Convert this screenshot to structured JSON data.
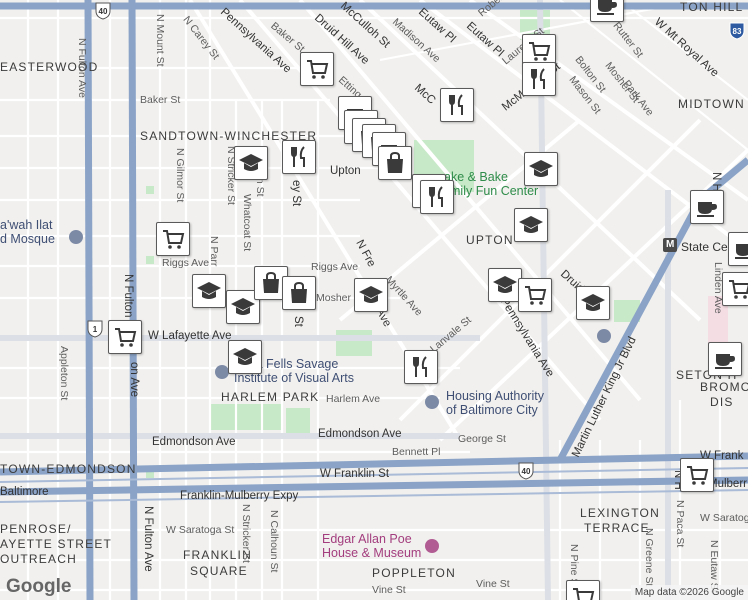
{
  "map": {
    "neighborhoods": [
      {
        "id": "easterwood",
        "text": "EASTERWOOD"
      },
      {
        "id": "sandtown",
        "text": "SANDTOWN-WINCHESTER"
      },
      {
        "id": "upton",
        "text": "UPTON"
      },
      {
        "id": "midtown",
        "text": "MIDTOWN"
      },
      {
        "id": "harlem-park",
        "text": "HARLEM PARK"
      },
      {
        "id": "seton-hill",
        "text": "SETON H"
      },
      {
        "id": "lexington",
        "text": "LEXINGTON"
      },
      {
        "id": "terrace",
        "text": "TERRACE"
      },
      {
        "id": "poppleton",
        "text": "POPPLETON"
      },
      {
        "id": "franklin",
        "text": "FRANKLIN"
      },
      {
        "id": "square",
        "text": "SQUARE"
      },
      {
        "id": "penrose1",
        "text": "PENROSE/"
      },
      {
        "id": "penrose2",
        "text": "AYETTE STREET"
      },
      {
        "id": "penrose3",
        "text": "OUTREACH"
      },
      {
        "id": "edmondson",
        "text": "TOWN-EDMONDSON"
      },
      {
        "id": "upton-hill",
        "text": "TON HILL"
      },
      {
        "id": "bromo",
        "text": "BROMO"
      },
      {
        "id": "dis",
        "text": "DIS"
      }
    ],
    "streets": [
      {
        "id": "n-fulton",
        "text": "N Fulton Ave"
      },
      {
        "id": "n-mount",
        "text": "N Mount St"
      },
      {
        "id": "n-carey",
        "text": "N Carey St"
      },
      {
        "id": "baker-st",
        "text": "Baker St"
      },
      {
        "id": "baker-st2",
        "text": "Baker St"
      },
      {
        "id": "penn-ave",
        "text": "Pennsylvania Ave"
      },
      {
        "id": "druid-hill",
        "text": "Druid Hill Ave"
      },
      {
        "id": "mcculloh",
        "text": "McCulloh St"
      },
      {
        "id": "madison",
        "text": "Madison Ave"
      },
      {
        "id": "eutaw-pl",
        "text": "Eutaw Pl"
      },
      {
        "id": "eutaw-pl2",
        "text": "Eutaw Pl"
      },
      {
        "id": "robert",
        "text": "Robert St"
      },
      {
        "id": "laurens",
        "text": "Laurens St"
      },
      {
        "id": "w-mt-royal",
        "text": "W Mt Royal Ave"
      },
      {
        "id": "rutter",
        "text": "Rutter St"
      },
      {
        "id": "bolton",
        "text": "Bolton St"
      },
      {
        "id": "mason",
        "text": "Mason St"
      },
      {
        "id": "mosher-st",
        "text": "Mosher St"
      },
      {
        "id": "park-ave",
        "text": "Park Ave"
      },
      {
        "id": "mcmechen",
        "text": "McMechen St"
      },
      {
        "id": "mcc2",
        "text": "McC"
      },
      {
        "id": "etting",
        "text": "Etting St"
      },
      {
        "id": "n-gilmor",
        "text": "N Gilmor St"
      },
      {
        "id": "n-stricker",
        "text": "N Stricker St"
      },
      {
        "id": "whatcoat",
        "text": "Whatcoat St"
      },
      {
        "id": "n-parr",
        "text": "N Parr"
      },
      {
        "id": "upton-rd",
        "text": "Upton"
      },
      {
        "id": "riggs",
        "text": "Riggs Ave"
      },
      {
        "id": "riggs2",
        "text": "Riggs Ave"
      },
      {
        "id": "mosher2",
        "text": "Mosher S"
      },
      {
        "id": "myrtle",
        "text": "Myrtle Ave"
      },
      {
        "id": "n-fre",
        "text": "N Fre"
      },
      {
        "id": "ave",
        "text": "Ave"
      },
      {
        "id": "w-lafayette",
        "text": "W Lafayette Ave"
      },
      {
        "id": "lanvale",
        "text": "Lanvale St"
      },
      {
        "id": "penn-ave2",
        "text": "Pennsylvania Ave"
      },
      {
        "id": "druid-h",
        "text": "Druid H"
      },
      {
        "id": "mlk",
        "text": "Martin Luther King Jr Blvd"
      },
      {
        "id": "n-how",
        "text": "N How"
      },
      {
        "id": "linden",
        "text": "Linden Ave"
      },
      {
        "id": "appleton",
        "text": "Appleton St"
      },
      {
        "id": "harlem-ave",
        "text": "Harlem Ave"
      },
      {
        "id": "edmondson-ave",
        "text": "Edmondson Ave"
      },
      {
        "id": "edmondson-ave2",
        "text": "Edmondson Ave"
      },
      {
        "id": "george",
        "text": "George St"
      },
      {
        "id": "bennett",
        "text": "Bennett Pl"
      },
      {
        "id": "w-franklin",
        "text": "W Franklin St"
      },
      {
        "id": "w-franklin2",
        "text": "W Frank"
      },
      {
        "id": "baltimore",
        "text": "Baltimore"
      },
      {
        "id": "franklin-mulberry",
        "text": "Franklin-Mulberry Expy"
      },
      {
        "id": "mulberry",
        "text": "Mulberr"
      },
      {
        "id": "w-saratoga",
        "text": "W Saratoga St"
      },
      {
        "id": "w-saratoga2",
        "text": "W Saratoga"
      },
      {
        "id": "n-fulton2",
        "text": "N Fulton Ave"
      },
      {
        "id": "n-stricker2",
        "text": "N Stricker St"
      },
      {
        "id": "n-calhoun",
        "text": "N Calhoun St"
      },
      {
        "id": "n-pine",
        "text": "N Pine St"
      },
      {
        "id": "n-greene",
        "text": "N Greene St"
      },
      {
        "id": "n-paca",
        "text": "N Paca St"
      },
      {
        "id": "n-eutaw",
        "text": "N Eutaw St"
      },
      {
        "id": "vine",
        "text": "Vine St"
      },
      {
        "id": "vine2",
        "text": "Vine St"
      },
      {
        "id": "on-ave",
        "text": "on Ave"
      },
      {
        "id": "un-st",
        "text": "un St"
      },
      {
        "id": "ey-st",
        "text": "ey St"
      },
      {
        "id": "st",
        "text": "St"
      },
      {
        "id": "n-fulton3",
        "text": "N Fulton Ave"
      },
      {
        "id": "n-h",
        "text": "N H"
      }
    ],
    "pois": [
      {
        "id": "masjid1",
        "text": "a'wah Ilat"
      },
      {
        "id": "masjid2",
        "text": "d Mosque"
      },
      {
        "id": "augusta1",
        "text": "gusta Fells Savage"
      },
      {
        "id": "augusta2",
        "text": "Institute of Visual Arts"
      },
      {
        "id": "housing1",
        "text": "Housing Authority"
      },
      {
        "id": "housing2",
        "text": "of Baltimore City"
      },
      {
        "id": "poe1",
        "text": "Edgar Allan Poe"
      },
      {
        "id": "poe2",
        "text": "House & Museum"
      },
      {
        "id": "fun1",
        "text": "ake & Bake"
      },
      {
        "id": "fun2",
        "text": "mily Fun Center"
      },
      {
        "id": "state-center",
        "text": "State Ce"
      }
    ],
    "shields": [
      {
        "id": "us40-top",
        "text": "40"
      },
      {
        "id": "us40-mid",
        "text": "40"
      },
      {
        "id": "us1",
        "text": "1"
      },
      {
        "id": "i83",
        "text": "83"
      }
    ],
    "metro_label": "M",
    "markers": [
      {
        "type": "grocery-cart-icon"
      },
      {
        "type": "grocery-cart-icon"
      },
      {
        "type": "restaurant-icon"
      },
      {
        "type": "restaurant-icon"
      },
      {
        "type": "coffee-icon"
      },
      {
        "type": "school-icon"
      },
      {
        "type": "shopping-bag-icon"
      },
      {
        "type": "coffee-icon"
      }
    ],
    "google_logo": "Google",
    "attribution": "Map data ©2026 Google"
  }
}
